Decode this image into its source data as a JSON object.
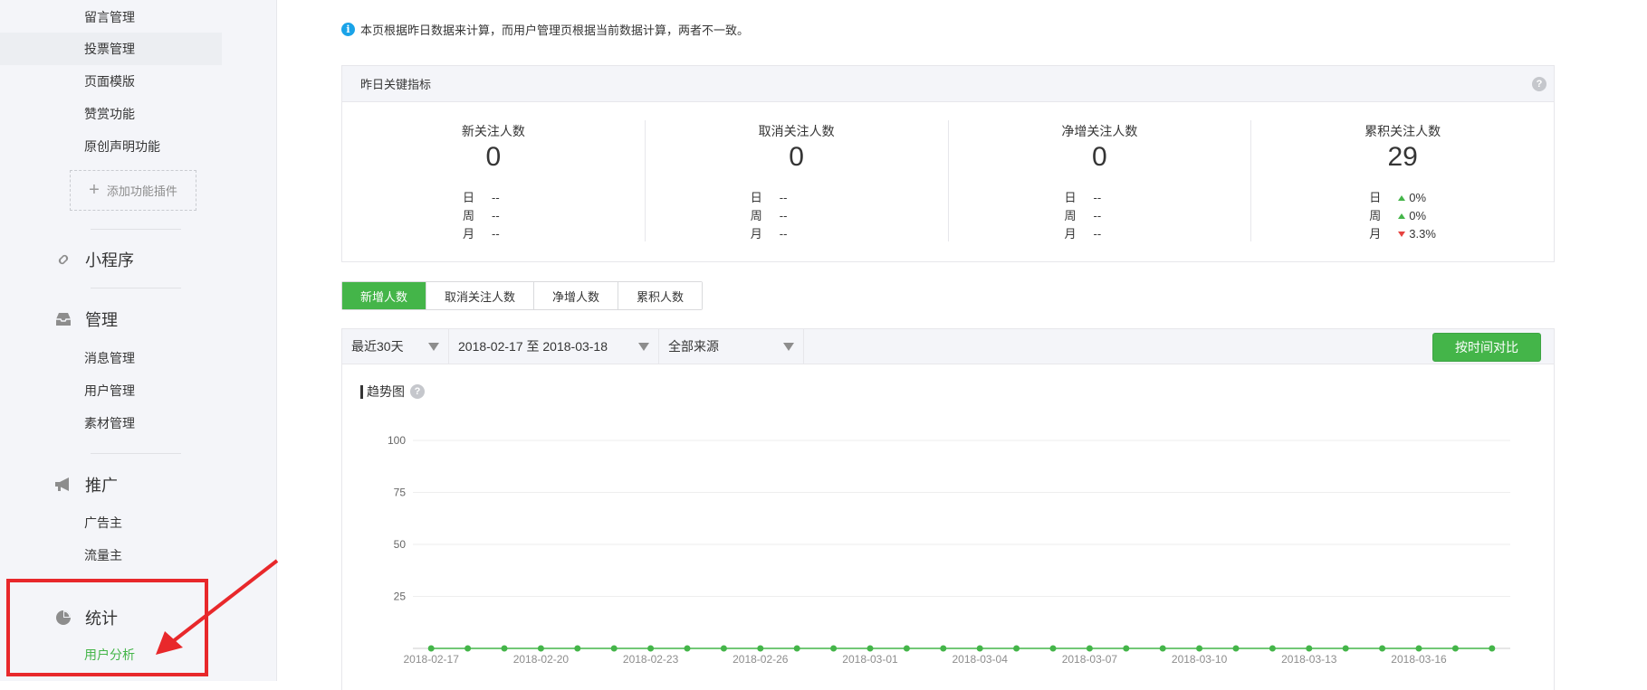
{
  "sidebar": {
    "top_items": [
      "留言管理",
      "投票管理",
      "页面模版",
      "赞赏功能",
      "原创声明功能"
    ],
    "add_plugin": "添加功能插件",
    "sections": [
      {
        "label": "小程序",
        "icon": "link-icon",
        "items": []
      },
      {
        "label": "管理",
        "icon": "inbox-icon",
        "items": [
          "消息管理",
          "用户管理",
          "素材管理"
        ]
      },
      {
        "label": "推广",
        "icon": "megaphone-icon",
        "items": [
          "广告主",
          "流量主"
        ]
      },
      {
        "label": "统计",
        "icon": "pie-chart-icon",
        "items": [
          "用户分析"
        ]
      }
    ],
    "active_item": "用户分析"
  },
  "notice": {
    "icon": "info-icon",
    "text": "本页根据昨日数据来计算，而用户管理页根据当前数据计算，两者不一致。"
  },
  "kpi": {
    "title": "昨日关键指标",
    "columns": [
      {
        "title": "新关注人数",
        "value": "0",
        "rows": [
          {
            "k": "日",
            "v": "--",
            "trend": ""
          },
          {
            "k": "周",
            "v": "--",
            "trend": ""
          },
          {
            "k": "月",
            "v": "--",
            "trend": ""
          }
        ]
      },
      {
        "title": "取消关注人数",
        "value": "0",
        "rows": [
          {
            "k": "日",
            "v": "--",
            "trend": ""
          },
          {
            "k": "周",
            "v": "--",
            "trend": ""
          },
          {
            "k": "月",
            "v": "--",
            "trend": ""
          }
        ]
      },
      {
        "title": "净增关注人数",
        "value": "0",
        "rows": [
          {
            "k": "日",
            "v": "--",
            "trend": ""
          },
          {
            "k": "周",
            "v": "--",
            "trend": ""
          },
          {
            "k": "月",
            "v": "--",
            "trend": ""
          }
        ]
      },
      {
        "title": "累积关注人数",
        "value": "29",
        "rows": [
          {
            "k": "日",
            "v": "0%",
            "trend": "up"
          },
          {
            "k": "周",
            "v": "0%",
            "trend": "up"
          },
          {
            "k": "月",
            "v": "3.3%",
            "trend": "down"
          }
        ]
      }
    ]
  },
  "tabs": [
    "新增人数",
    "取消关注人数",
    "净增人数",
    "累积人数"
  ],
  "active_tab": "新增人数",
  "filter": {
    "range": "最近30天",
    "dates": "2018-02-17 至 2018-03-18",
    "source": "全部来源",
    "compare_button": "按时间对比"
  },
  "trend": {
    "title": "趋势图"
  },
  "colors": {
    "accent": "#44b549",
    "down": "#e64340",
    "info": "#1aa3e8",
    "highlight": "#e8282b"
  },
  "chart_data": {
    "type": "line",
    "title": "趋势图",
    "ylim": [
      0,
      100
    ],
    "yticks": [
      25,
      50,
      75,
      100
    ],
    "x": [
      "2018-02-17",
      "2018-02-18",
      "2018-02-19",
      "2018-02-20",
      "2018-02-21",
      "2018-02-22",
      "2018-02-23",
      "2018-02-24",
      "2018-02-25",
      "2018-02-26",
      "2018-02-27",
      "2018-02-28",
      "2018-03-01",
      "2018-03-02",
      "2018-03-03",
      "2018-03-04",
      "2018-03-05",
      "2018-03-06",
      "2018-03-07",
      "2018-03-08",
      "2018-03-09",
      "2018-03-10",
      "2018-03-11",
      "2018-03-12",
      "2018-03-13",
      "2018-03-14",
      "2018-03-15",
      "2018-03-16",
      "2018-03-17",
      "2018-03-18"
    ],
    "xticks": [
      "2018-02-17",
      "2018-02-20",
      "2018-02-23",
      "2018-02-26",
      "2018-03-01",
      "2018-03-04",
      "2018-03-07",
      "2018-03-10",
      "2018-03-13",
      "2018-03-16"
    ],
    "series": [
      {
        "values": [
          0,
          0,
          0,
          0,
          0,
          0,
          0,
          0,
          0,
          0,
          0,
          0,
          0,
          0,
          0,
          0,
          0,
          0,
          0,
          0,
          0,
          0,
          0,
          0,
          0,
          0,
          0,
          0,
          0,
          0
        ]
      }
    ],
    "grid": true
  }
}
